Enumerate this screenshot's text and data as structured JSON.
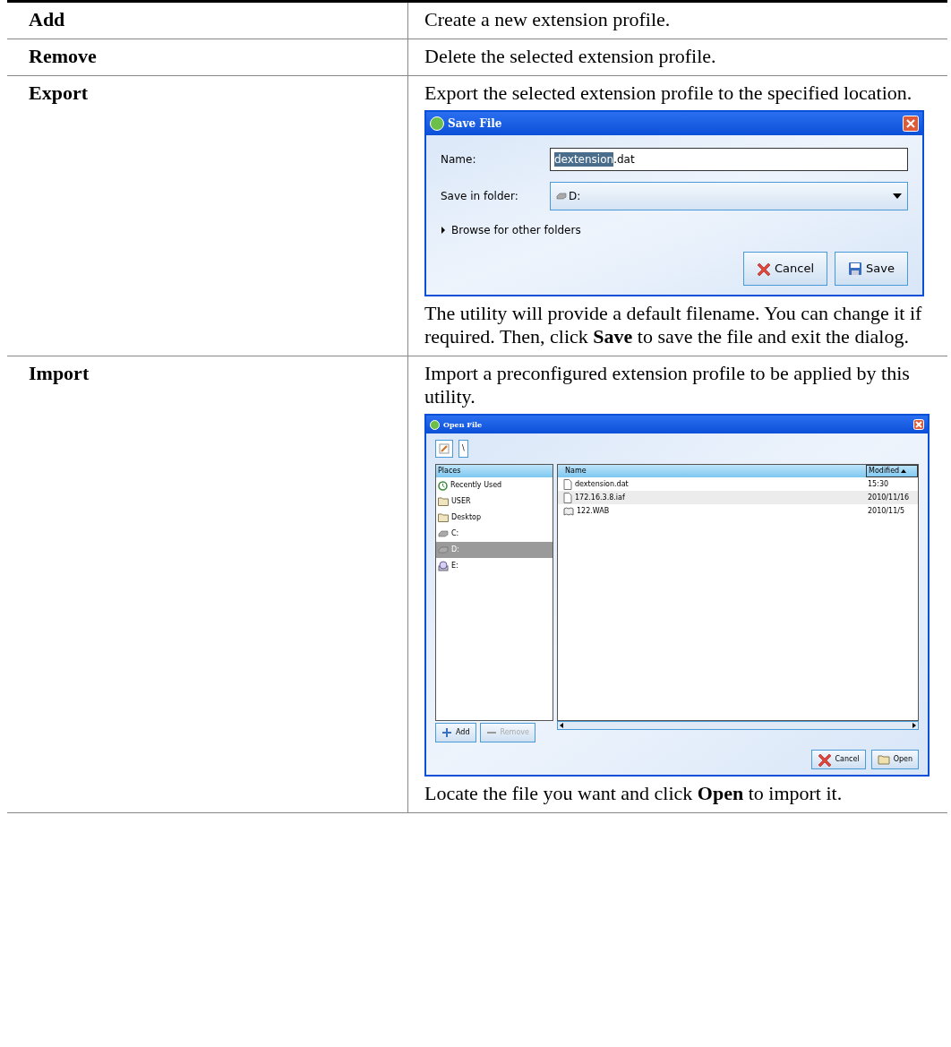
{
  "rows": [
    {
      "label": "Add",
      "description": "Create a new extension profile."
    },
    {
      "label": "Remove",
      "description": "Delete the selected extension profile."
    },
    {
      "label": "Export",
      "description": "Export the selected extension profile to the specified location.",
      "dialog": {
        "kind": "save",
        "title": "Save File",
        "name_label": "Name:",
        "name_selected": "dextension",
        "name_rest": ".dat",
        "folder_label": "Save in folder:",
        "folder_value": "D:",
        "expander": "Browse for other folders",
        "expanded": false,
        "buttons": [
          {
            "kind": "cancel",
            "label": "Cancel"
          },
          {
            "kind": "save",
            "label": "Save"
          }
        ]
      },
      "note": "The utility will provide a default filename. You can change it if required. Then, click **Save** to save the file and exit the dialog."
    },
    {
      "label": "Import",
      "description": "Import a preconfigured extension profile to be applied by this utility.",
      "dialog": {
        "kind": "open",
        "title": "Open File",
        "path_button": "\\",
        "places_header": "Places",
        "places": [
          {
            "kind": "recent",
            "label": "Recently Used",
            "selected": false
          },
          {
            "kind": "folder",
            "label": "USER",
            "selected": false
          },
          {
            "kind": "folder",
            "label": "Desktop",
            "selected": false
          },
          {
            "kind": "drive",
            "label": "C:",
            "selected": false
          },
          {
            "kind": "drive",
            "label": "D:",
            "selected": true
          },
          {
            "kind": "disc",
            "label": "E:",
            "selected": false
          }
        ],
        "columns": [
          "Name",
          "Modified"
        ],
        "files": [
          {
            "kind": "file",
            "name": "dextension.dat",
            "modified": "15:30",
            "selected": false
          },
          {
            "kind": "file",
            "name": "172.16.3.8.iaf",
            "modified": "2010/11/16",
            "selected": true
          },
          {
            "kind": "book",
            "name": "122.WAB",
            "modified": "2010/11/5",
            "selected": false
          }
        ],
        "side_buttons": [
          {
            "kind": "add",
            "label": "Add",
            "disabled": false
          },
          {
            "kind": "remove",
            "label": "Remove",
            "disabled": true
          }
        ],
        "buttons": [
          {
            "kind": "cancel",
            "label": "Cancel"
          },
          {
            "kind": "open",
            "label": "Open"
          }
        ]
      },
      "note": "Locate the file you want and click **Open** to import it."
    }
  ]
}
